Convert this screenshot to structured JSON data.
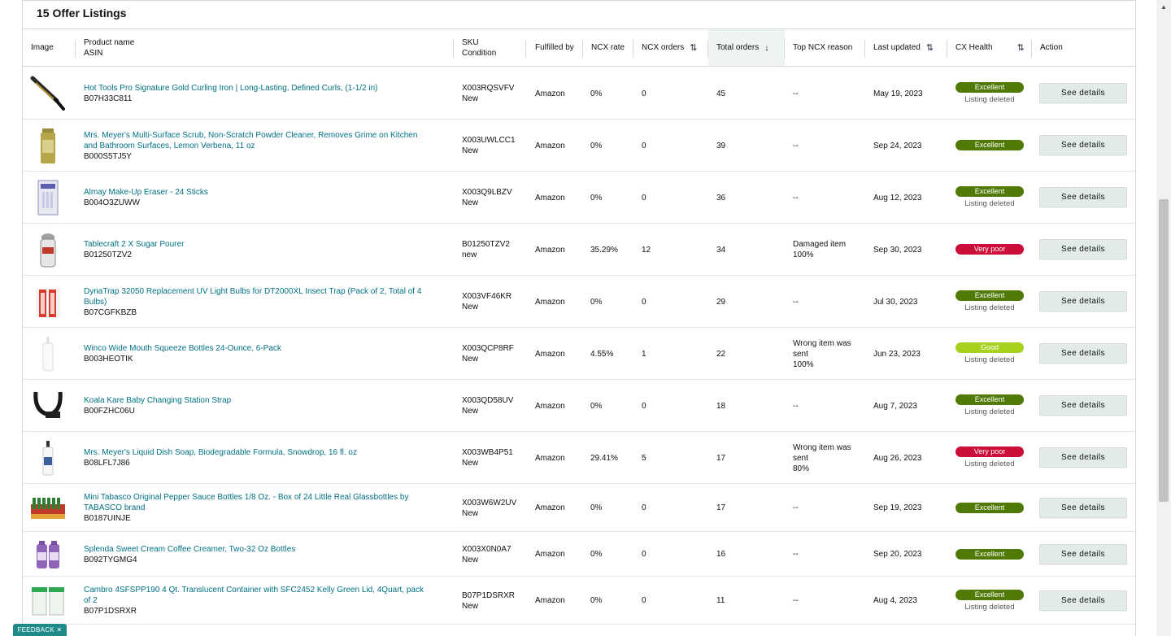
{
  "title": "15 Offer Listings",
  "headers": {
    "image": "Image",
    "product_name": "Product name",
    "asin": "ASIN",
    "sku": "SKU",
    "condition": "Condition",
    "fulfilled_by": "Fulfilled by",
    "ncx_rate": "NCX rate",
    "ncx_orders": "NCX orders",
    "total_orders": "Total orders",
    "top_ncx_reason": "Top NCX reason",
    "last_updated": "Last updated",
    "cx_health": "CX Health",
    "action": "Action"
  },
  "sort_icons": {
    "ncx_orders": "sort-updown-icon",
    "total_orders": "sort-down-icon",
    "last_updated": "sort-updown-icon",
    "cx_health": "sort-updown-icon"
  },
  "rows": [
    {
      "name_lines": [
        "Hot Tools Pro Signature Gold Curling Iron | Long-Lasting, Defined Curls, (1-1/2 in)"
      ],
      "asin": "B07H33C811",
      "sku": "X003RQSVFV",
      "condition": "New",
      "fulfilled": "Amazon",
      "ncx_rate": "0%",
      "ncx_orders": "0",
      "total_orders": "45",
      "reason_lines": [
        "--"
      ],
      "updated": "May 19, 2023",
      "health": "Excellent",
      "note": "Listing deleted",
      "action": "See details",
      "thumb": "curling-iron"
    },
    {
      "name_lines": [
        "Mrs. Meyer's Multi-Surface Scrub, Non-Scratch Powder Cleaner, Removes Grime on Kitchen",
        "and Bathroom Surfaces, Lemon Verbena, 11 oz"
      ],
      "asin": "B000S5TJ5Y",
      "sku": "X003UWLCC1",
      "condition": "New",
      "fulfilled": "Amazon",
      "ncx_rate": "0%",
      "ncx_orders": "0",
      "total_orders": "39",
      "reason_lines": [
        "--"
      ],
      "updated": "Sep 24, 2023",
      "health": "Excellent",
      "note": "",
      "action": "See details",
      "thumb": "can"
    },
    {
      "name_lines": [
        "Almay Make-Up Eraser - 24 Sticks"
      ],
      "asin": "B004O3ZUWW",
      "sku": "X003Q9LBZV",
      "condition": "New",
      "fulfilled": "Amazon",
      "ncx_rate": "0%",
      "ncx_orders": "0",
      "total_orders": "36",
      "reason_lines": [
        "--"
      ],
      "updated": "Aug 12, 2023",
      "health": "Excellent",
      "note": "Listing deleted",
      "action": "See details",
      "thumb": "box"
    },
    {
      "name_lines": [
        "Tablecraft 2 X Sugar Pourer"
      ],
      "asin": "B01250TZV2",
      "sku": "B01250TZV2",
      "condition": "new",
      "fulfilled": "Amazon",
      "ncx_rate": "35.29%",
      "ncx_orders": "12",
      "total_orders": "34",
      "reason_lines": [
        "Damaged item",
        "100%"
      ],
      "updated": "Sep 30, 2023",
      "health": "Very poor",
      "note": "",
      "action": "See details",
      "thumb": "jar"
    },
    {
      "name_lines": [
        "DynaTrap 32050 Replacement UV Light Bulbs for DT2000XL Insect Trap (Pack of 2, Total of 4",
        "Bulbs)"
      ],
      "asin": "B07CGFKBZB",
      "sku": "X003VF46KR",
      "condition": "New",
      "fulfilled": "Amazon",
      "ncx_rate": "0%",
      "ncx_orders": "0",
      "total_orders": "29",
      "reason_lines": [
        "--"
      ],
      "updated": "Jul 30, 2023",
      "health": "Excellent",
      "note": "Listing deleted",
      "action": "See details",
      "thumb": "bulbs"
    },
    {
      "name_lines": [
        "Winco Wide Mouth Squeeze Bottles 24-Ounce, 6-Pack"
      ],
      "asin": "B003HEOTIK",
      "sku": "X003QCP8RF",
      "condition": "New",
      "fulfilled": "Amazon",
      "ncx_rate": "4.55%",
      "ncx_orders": "1",
      "total_orders": "22",
      "reason_lines": [
        "Wrong item was",
        "sent",
        "100%"
      ],
      "updated": "Jun 23, 2023",
      "health": "Good",
      "note": "Listing deleted",
      "action": "See details",
      "thumb": "squeeze"
    },
    {
      "name_lines": [
        "Koala Kare Baby Changing Station Strap"
      ],
      "asin": "B00FZHC06U",
      "sku": "X003QD58UV",
      "condition": "New",
      "fulfilled": "Amazon",
      "ncx_rate": "0%",
      "ncx_orders": "0",
      "total_orders": "18",
      "reason_lines": [
        "--"
      ],
      "updated": "Aug 7, 2023",
      "health": "Excellent",
      "note": "Listing deleted",
      "action": "See details",
      "thumb": "strap"
    },
    {
      "name_lines": [
        "Mrs. Meyer's Liquid Dish Soap, Biodegradable Formula, Snowdrop, 16 fl. oz"
      ],
      "asin": "B08LFL7J86",
      "sku": "X003WB4P51",
      "condition": "New",
      "fulfilled": "Amazon",
      "ncx_rate": "29.41%",
      "ncx_orders": "5",
      "total_orders": "17",
      "reason_lines": [
        "Wrong item was",
        "sent",
        "80%"
      ],
      "updated": "Aug 26, 2023",
      "health": "Very poor",
      "note": "Listing deleted",
      "action": "See details",
      "thumb": "soap"
    },
    {
      "name_lines": [
        "Mini Tabasco Original Pepper Sauce Bottles 1/8 Oz. - Box of 24 Little Real Glassbottles by",
        "TABASCO brand"
      ],
      "asin": "B0187UINJE",
      "sku": "X003W6W2UV",
      "condition": "New",
      "fulfilled": "Amazon",
      "ncx_rate": "0%",
      "ncx_orders": "0",
      "total_orders": "17",
      "reason_lines": [
        "--"
      ],
      "updated": "Sep 19, 2023",
      "health": "Excellent",
      "note": "",
      "action": "See details",
      "thumb": "tabasco"
    },
    {
      "name_lines": [
        "Splenda Sweet Cream Coffee Creamer, Two-32 Oz Bottles"
      ],
      "asin": "B092TYGMG4",
      "sku": "X003X0N0A7",
      "condition": "New",
      "fulfilled": "Amazon",
      "ncx_rate": "0%",
      "ncx_orders": "0",
      "total_orders": "16",
      "reason_lines": [
        "--"
      ],
      "updated": "Sep 20, 2023",
      "health": "Excellent",
      "note": "",
      "action": "See details",
      "thumb": "creamer"
    },
    {
      "name_lines": [
        "Cambro 4SFSPP190 4 Qt. Translucent Container with SFC2452 Kelly Green Lid, 4Quart, pack",
        "of 2"
      ],
      "asin": "B07P1DSRXR",
      "sku": "B07P1DSRXR",
      "condition": "New",
      "fulfilled": "Amazon",
      "ncx_rate": "0%",
      "ncx_orders": "0",
      "total_orders": "11",
      "reason_lines": [
        "--"
      ],
      "updated": "Aug 4, 2023",
      "health": "Excellent",
      "note": "Listing deleted",
      "action": "See details",
      "thumb": "container"
    }
  ],
  "health_colors": {
    "Excellent": "#507a05",
    "Very poor": "#cc0c39",
    "Good": "#a7d11f"
  },
  "feedback_label": "FEEDBACK ✕",
  "scroll_up_icon": "▲"
}
